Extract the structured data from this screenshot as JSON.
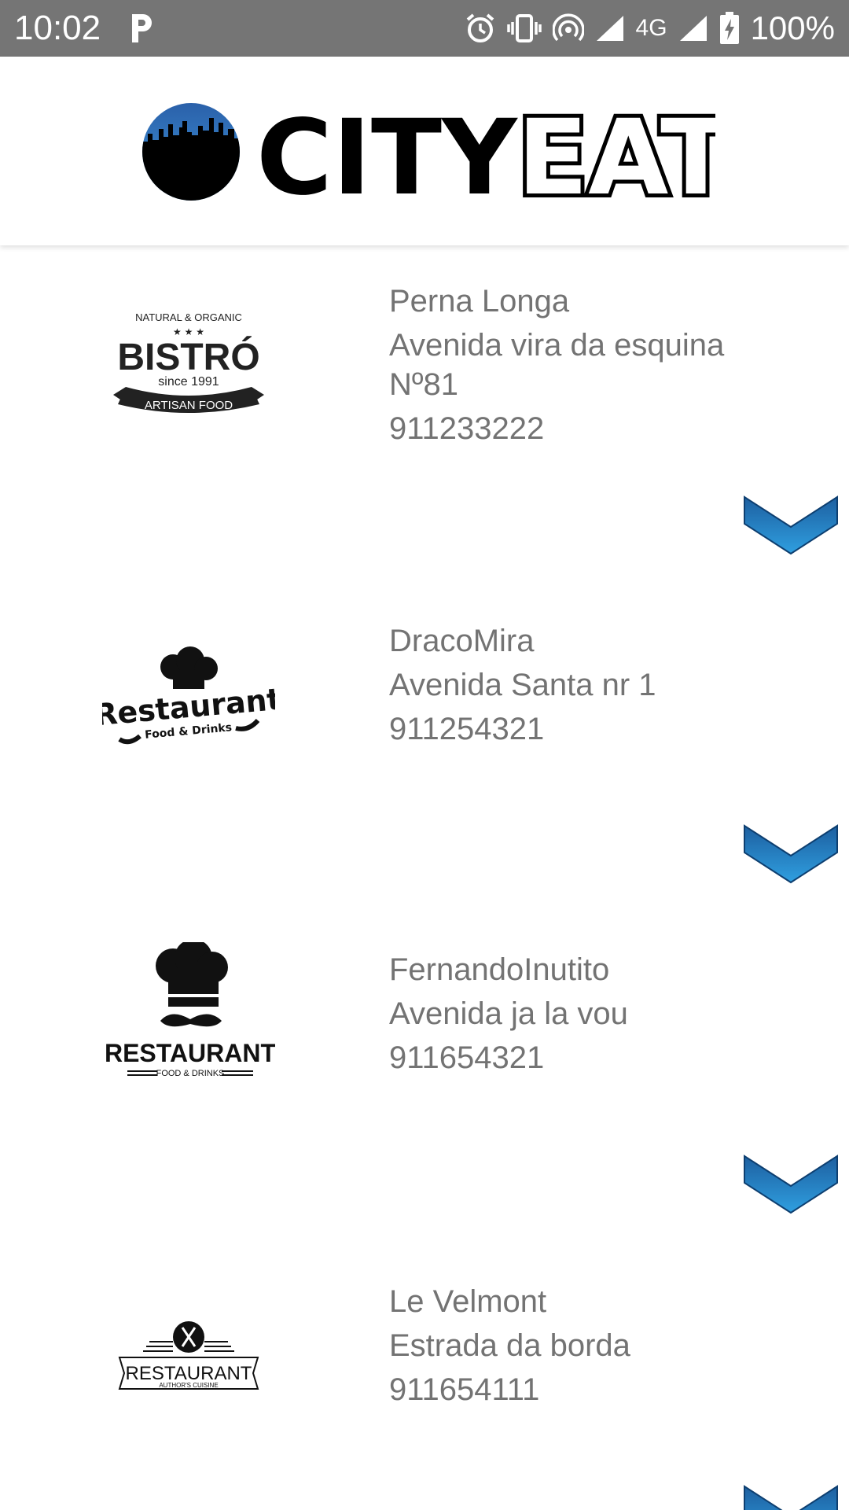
{
  "status_bar": {
    "time": "10:02",
    "network": "4G",
    "battery": "100%"
  },
  "header": {
    "logo_text_bold": "CITY",
    "logo_text_outline": "EAT",
    "logo_icon": "city-skyline-icon"
  },
  "colors": {
    "status_bar_bg": "#757575",
    "text_gray": "#737373",
    "accent_blue": "#1f86c9"
  },
  "restaurants": [
    {
      "name": "Perna Longa",
      "address": "Avenida vira da esquina Nº81",
      "phone": "911233222",
      "logo": {
        "top": "NATURAL & ORGANIC",
        "main": "BISTRÓ",
        "since": "since 1991",
        "banner": "ARTISAN FOOD"
      }
    },
    {
      "name": "DracoMira",
      "address": "Avenida Santa nr 1",
      "phone": "911254321",
      "logo": {
        "main": "Restaurant",
        "sub": "Food & Drinks"
      }
    },
    {
      "name": "FernandoInutito",
      "address": "Avenida ja la vou",
      "phone": "911654321",
      "logo": {
        "main": "RESTAURANT",
        "sub": "FOOD & DRINKS"
      }
    },
    {
      "name": "Le Velmont",
      "address": "Estrada da borda",
      "phone": "911654111",
      "logo": {
        "main": "RESTAURANT",
        "sub": "AUTHOR'S CUISINE"
      }
    }
  ]
}
